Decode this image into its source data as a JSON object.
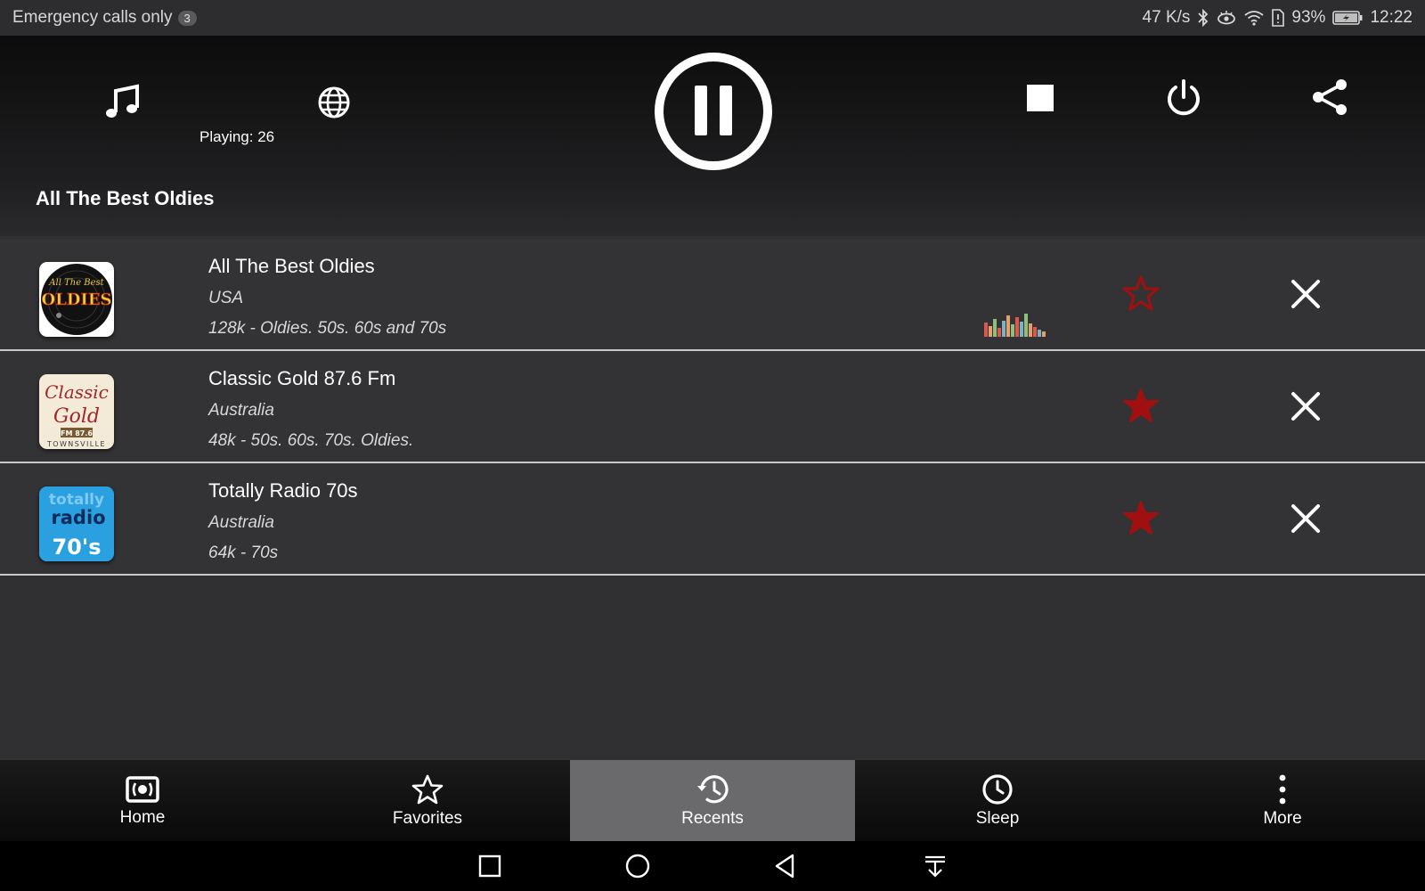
{
  "status_bar": {
    "carrier_text": "Emergency calls only",
    "notification_count": "3",
    "network_speed": "47 K/s",
    "battery_percent": "93%",
    "time": "12:22"
  },
  "player": {
    "playing_label": "Playing: 26",
    "current_station": "All The Best Oldies"
  },
  "stations": [
    {
      "name": "All The Best Oldies",
      "country": "USA",
      "description": "128k - Oldies. 50s. 60s and 70s",
      "favorite": false,
      "now_playing": true
    },
    {
      "name": "Classic Gold 87.6 Fm",
      "country": "Australia",
      "description": "48k - 50s. 60s. 70s. Oldies.",
      "favorite": true,
      "now_playing": false
    },
    {
      "name": "Totally Radio 70s",
      "country": "Australia",
      "description": "64k - 70s",
      "favorite": true,
      "now_playing": false
    }
  ],
  "logos": {
    "oldies": {
      "line1": "All The Best",
      "line2": "OLDIES"
    },
    "classic_gold": {
      "line1": "Classic",
      "line2": "Gold",
      "line3": "FM 87.6",
      "line4": "TOWNSVILLE"
    },
    "totally": {
      "line1": "totally",
      "line2": "radio",
      "line3": "70's"
    }
  },
  "bottom_nav": {
    "home": "Home",
    "favorites": "Favorites",
    "recents": "Recents",
    "sleep": "Sleep",
    "more": "More",
    "active": "recents"
  },
  "colors": {
    "favorite_star": "#a01010",
    "active_tab": "#6a6a6c"
  }
}
